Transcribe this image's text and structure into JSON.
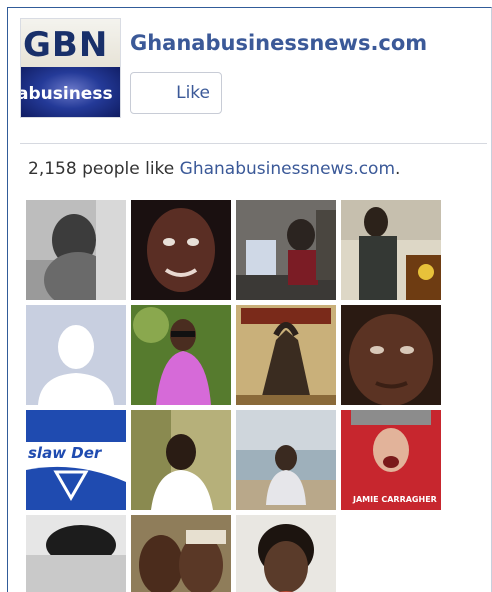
{
  "page": {
    "name": "Ghanabusinessnews.com",
    "like_button_label": "Like",
    "logo_text_top": "GBN",
    "logo_text_bottom": "abusiness"
  },
  "likes": {
    "count_text": "2,158 people like ",
    "page_link": "Ghanabusinessnews.com",
    "suffix": "."
  },
  "fans": [
    {
      "id": 1,
      "tone": "#8a8a8a"
    },
    {
      "id": 2,
      "tone": "#4a2a22"
    },
    {
      "id": 3,
      "tone": "#6d6a66"
    },
    {
      "id": 4,
      "tone": "#3b3323"
    },
    {
      "id": 5,
      "tone": "#c8cfe0"
    },
    {
      "id": 6,
      "tone": "#6c8f3d"
    },
    {
      "id": 7,
      "tone": "#8a5a3b"
    },
    {
      "id": 8,
      "tone": "#4a2c1d"
    },
    {
      "id": 9,
      "tone": "#1e4aa8"
    },
    {
      "id": 10,
      "tone": "#8f8a60"
    },
    {
      "id": 11,
      "tone": "#a9b2ba"
    },
    {
      "id": 12,
      "tone": "#b2222a"
    },
    {
      "id": 13,
      "tone": "#9a9a9a"
    },
    {
      "id": 14,
      "tone": "#5a3d29"
    },
    {
      "id": 15,
      "tone": "#e6e4df"
    }
  ]
}
